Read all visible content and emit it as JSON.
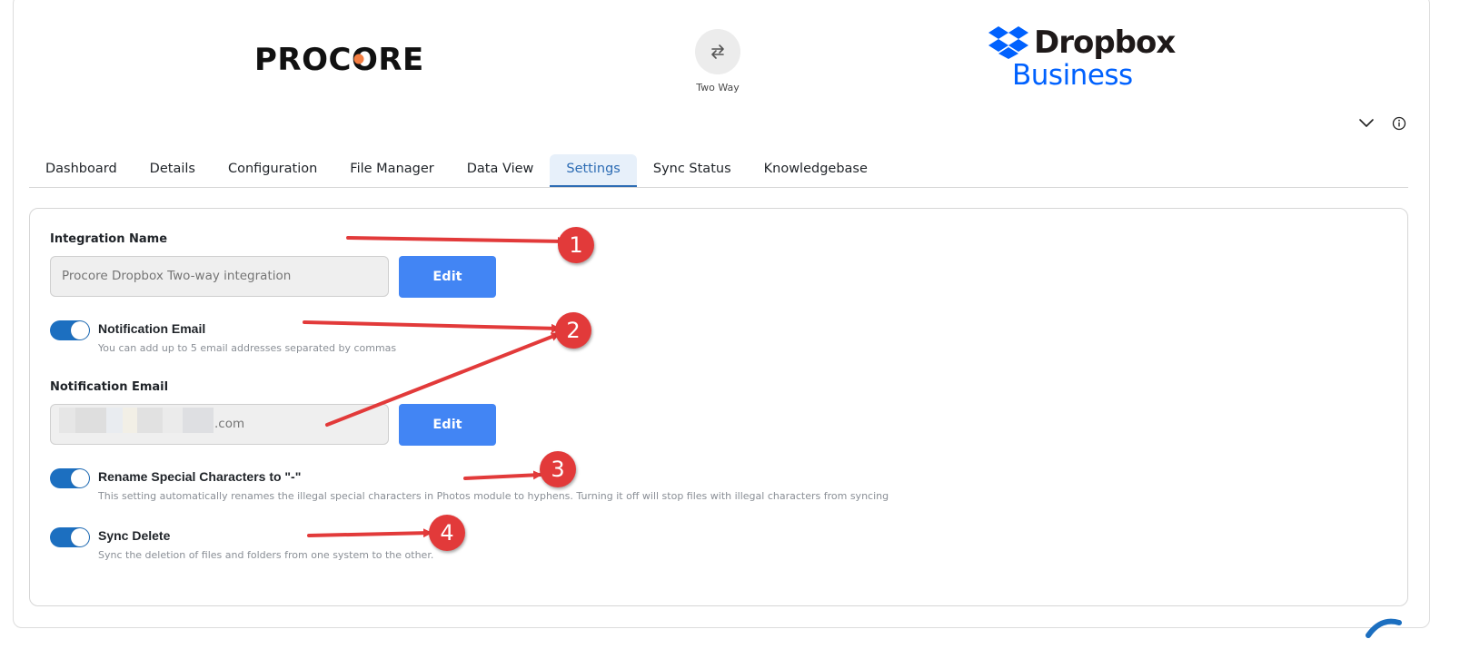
{
  "header": {
    "left_brand": "PROCORE",
    "sync_mode_label": "Two Way",
    "right_brand_line1": "Dropbox",
    "right_brand_line2": "Business",
    "colors": {
      "procore_orange": "#f47e42",
      "dropbox_blue": "#0061fe"
    }
  },
  "tabs": [
    {
      "label": "Dashboard"
    },
    {
      "label": "Details"
    },
    {
      "label": "Configuration"
    },
    {
      "label": "File Manager"
    },
    {
      "label": "Data View"
    },
    {
      "label": "Settings",
      "active": true
    },
    {
      "label": "Sync Status"
    },
    {
      "label": "Knowledgebase"
    }
  ],
  "settings": {
    "integration_name": {
      "label": "Integration Name",
      "value": "Procore Dropbox Two-way integration",
      "edit_label": "Edit"
    },
    "notification_toggle": {
      "title": "Notification Email",
      "description": "You can add up to 5 email addresses separated by commas",
      "enabled": true
    },
    "notification_email": {
      "label": "Notification Email",
      "value": ".com",
      "edit_label": "Edit"
    },
    "rename_toggle": {
      "title": "Rename Special Characters to \"-\"",
      "description": "This setting automatically renames the illegal special characters in Photos module to hyphens. Turning it off will stop files with illegal characters from syncing",
      "enabled": true
    },
    "sync_delete_toggle": {
      "title": "Sync Delete",
      "description": "Sync the deletion of files and folders from one system to the other.",
      "enabled": true
    }
  },
  "annotations": [
    {
      "number": "1"
    },
    {
      "number": "2"
    },
    {
      "number": "3"
    },
    {
      "number": "4"
    }
  ],
  "icons": [
    "swap-arrows-icon",
    "chevron-down-icon",
    "info-icon",
    "dropbox-logo-icon"
  ],
  "accent_colors": {
    "tab_active": "#2d6cb4",
    "button": "#4285f4",
    "toggle": "#1c6fc0",
    "annotation": "#e23a3a"
  }
}
